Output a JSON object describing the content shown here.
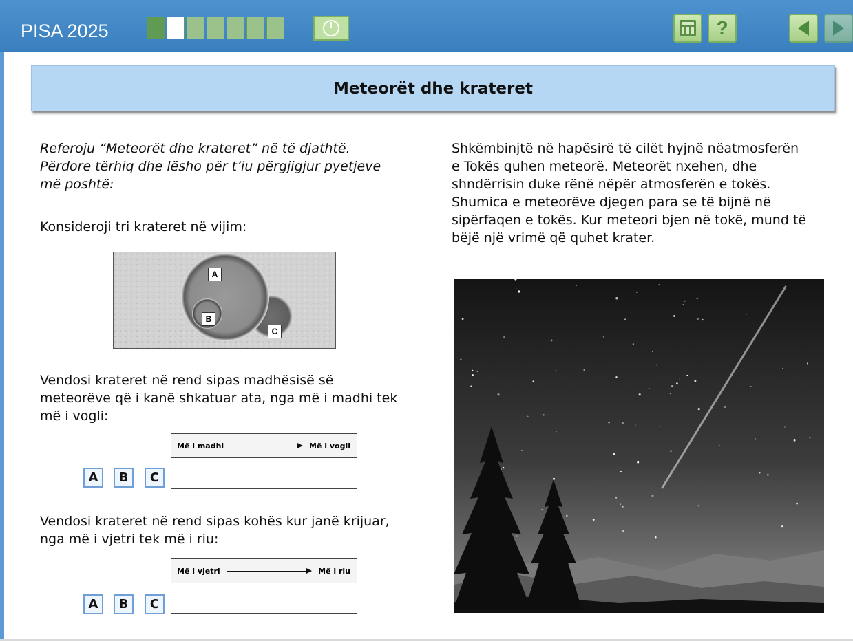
{
  "header": {
    "brand": "PISA 2025",
    "progress": {
      "total": 7,
      "completed": 1,
      "current_index": 2
    },
    "icons": {
      "timer": "clock-icon",
      "calculator": "calculator-icon",
      "help": "help-icon",
      "prev": "arrow-left-icon",
      "next": "arrow-right-icon"
    },
    "help_glyph": "?"
  },
  "title": "Meteorët dhe krateret",
  "left": {
    "instruction_lines": [
      "Referoju “Meteorët dhe krateret” në të djathtë.",
      "Përdore tërhiq dhe lësho për t’iu përgjigjur pyetjeve",
      "më poshtë:"
    ],
    "consider": "Konsideroji tri krateret në vijim:",
    "crater_labels": [
      "A",
      "B",
      "C"
    ],
    "question1_lines": [
      "Vendosi krateret në rend sipas madhësisë së",
      "meteorëve që i kanë shkatuar ata, nga më i madhi tek",
      "më i vogli:"
    ],
    "table1": {
      "left_header": "Më i madhi",
      "right_header": "Më i vogli"
    },
    "question2_lines": [
      "Vendosi krateret në rend sipas kohës kur janë krijuar,",
      "nga më i vjetri tek më i riu:"
    ],
    "table2": {
      "left_header": "Më i vjetri",
      "right_header": "Më i riu"
    },
    "drag_options": [
      "A",
      "B",
      "C"
    ]
  },
  "right": {
    "paragraph_lines": [
      "Shkëmbinjtë në hapësirë të cilët hyjnë nëatmosferën",
      "e Tokës quhen meteorë. Meteorët nxehen, dhe",
      "shndërrisin duke rënë nëpër atmosferën e tokës.",
      "Shumica e meteorëve djegen para se të bijnë në",
      "sipërfaqen e tokës. Kur meteori bjen në tokë, mund të",
      "bëjë një vrimë që quhet krater."
    ]
  },
  "colors": {
    "header_blue": "#3f84c5",
    "title_bar": "#b6d7f3",
    "green": "#7ab05e"
  }
}
